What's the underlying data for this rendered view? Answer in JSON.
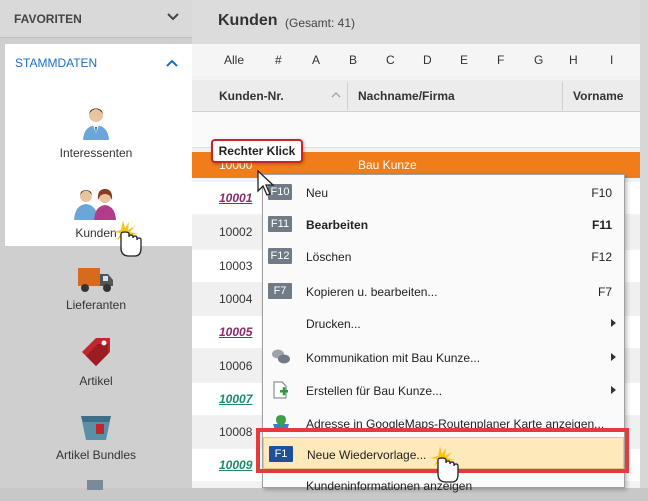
{
  "sidebar": {
    "favoriten_label": "FAVORITEN",
    "stammdaten_label": "STAMMDATEN",
    "items": [
      {
        "label": "Interessenten",
        "icon": "person-icon"
      },
      {
        "label": "Kunden",
        "icon": "persons-icon"
      },
      {
        "label": "Lieferanten",
        "icon": "truck-icon"
      },
      {
        "label": "Artikel",
        "icon": "tag-icon"
      },
      {
        "label": "Artikel Bundles",
        "icon": "basket-icon"
      }
    ]
  },
  "main": {
    "title": "Kunden",
    "count": "(Gesamt: 41)",
    "letters": [
      "Alle",
      "#",
      "A",
      "B",
      "C",
      "D",
      "E",
      "F",
      "G",
      "H",
      "I"
    ],
    "columns": [
      "Kunden-Nr.",
      "Nachname/Firma",
      "Vorname"
    ],
    "rows": [
      {
        "num": "10000",
        "name": "Bau Kunze"
      },
      {
        "num": "10001",
        "name": ""
      },
      {
        "num": "10002",
        "name": ""
      },
      {
        "num": "10003",
        "name": ""
      },
      {
        "num": "10004",
        "name": ""
      },
      {
        "num": "10005",
        "name": ""
      },
      {
        "num": "10006",
        "name": ""
      },
      {
        "num": "10007",
        "name": ""
      },
      {
        "num": "10008",
        "name": ""
      },
      {
        "num": "10009",
        "name": ""
      }
    ]
  },
  "context_menu": {
    "items": [
      {
        "key": "F10",
        "label": "Neu",
        "shortcut": "F10"
      },
      {
        "key": "F11",
        "label": "Bearbeiten",
        "shortcut": "F11"
      },
      {
        "key": "F12",
        "label": "Löschen",
        "shortcut": "F12"
      },
      {
        "key": "F7",
        "label": "Kopieren u. bearbeiten...",
        "shortcut": "F7"
      },
      {
        "key": "",
        "label": "Drucken...",
        "shortcut": ""
      },
      {
        "key": "",
        "label": "Kommunikation mit Bau Kunze...",
        "shortcut": ""
      },
      {
        "key": "",
        "label": "Erstellen für Bau Kunze...",
        "shortcut": ""
      },
      {
        "key": "",
        "label": "Adresse in GoogleMaps-Routenplaner Karte anzeigen...",
        "shortcut": ""
      },
      {
        "key": "F1",
        "label": "Neue Wiedervorlage...",
        "shortcut": ""
      },
      {
        "key": "",
        "label": "Kundeninformationen anzeigen",
        "shortcut": ""
      }
    ]
  },
  "callout": {
    "text": "Rechter Klick"
  },
  "colors": {
    "selected_row": "#f07d19",
    "accent_blue": "#1a6fc9",
    "highlight_border": "#e8393d",
    "highlight_bg": "#fde9b9"
  }
}
